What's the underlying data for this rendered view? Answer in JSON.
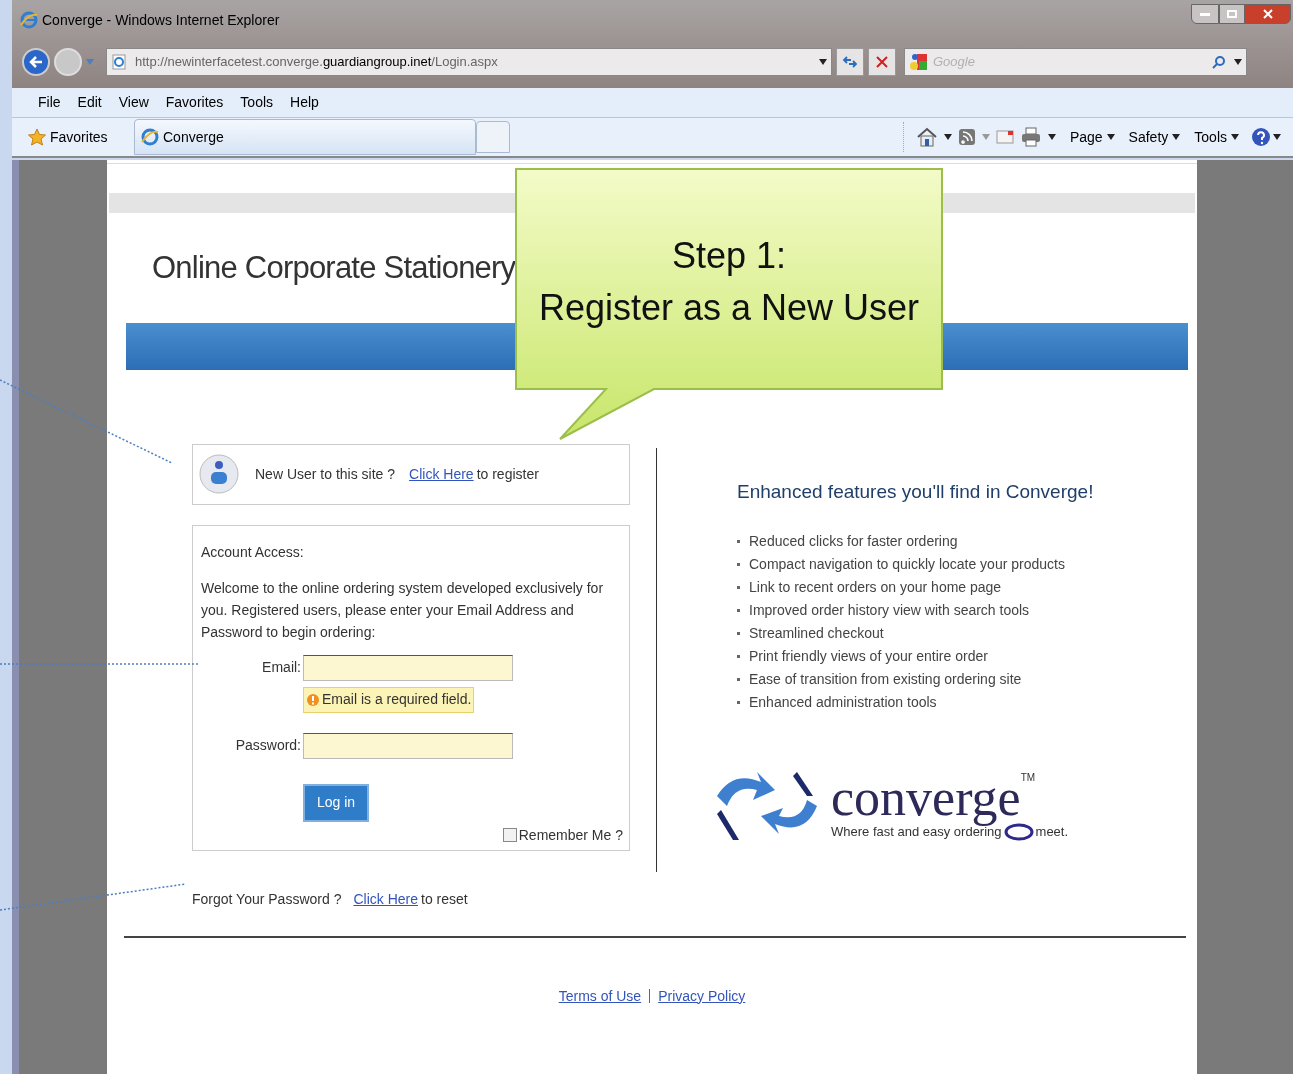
{
  "window": {
    "title": "Converge - Windows Internet Explorer"
  },
  "address_bar": {
    "url_prefix": "http://newinterfacetest.converge.",
    "url_domain": "guardiangroup.inet",
    "url_path": "/Login.aspx"
  },
  "search_box": {
    "placeholder": "Google"
  },
  "menu_bar": [
    "File",
    "Edit",
    "View",
    "Favorites",
    "Tools",
    "Help"
  ],
  "favorites_bar": {
    "favorites": "Favorites",
    "tab": "Converge",
    "commands": [
      "Page",
      "Safety",
      "Tools"
    ]
  },
  "page": {
    "site_title": "Online Corporate Stationery",
    "callout": [
      "Step 1:",
      "Register as a New User"
    ],
    "new_user": {
      "text": "New User to this site ?",
      "link": "Click Here",
      "suffix": "to register"
    },
    "account": {
      "heading": "Account Access:",
      "intro": "Welcome to the online ordering system developed exclusively for you. Registered users, please enter your Email Address and Password to begin ordering:",
      "email_label": "Email:",
      "email_error": "Email is a required field.",
      "password_label": "Password:",
      "login_button": "Log in",
      "remember_label": "Remember Me ?",
      "remember_checked": false
    },
    "forgot": {
      "text": "Forgot Your Password ?",
      "link": "Click Here",
      "suffix": "to reset"
    },
    "features": {
      "heading": "Enhanced features you'll find in Converge!",
      "items": [
        "Reduced clicks for faster ordering",
        "Compact navigation to quickly locate your products",
        "Link to recent orders on your home page",
        "Improved order history view with search tools",
        "Streamlined checkout",
        "Print friendly views of your entire order",
        "Ease of transition from existing ordering site",
        "Enhanced administration tools"
      ]
    },
    "logo": {
      "wordmark": "converge",
      "trademark": "TM",
      "tagline": "Where fast and easy ordering",
      "tagline_end": "meet."
    },
    "footer": [
      "Terms of Use",
      "Privacy Policy"
    ]
  }
}
